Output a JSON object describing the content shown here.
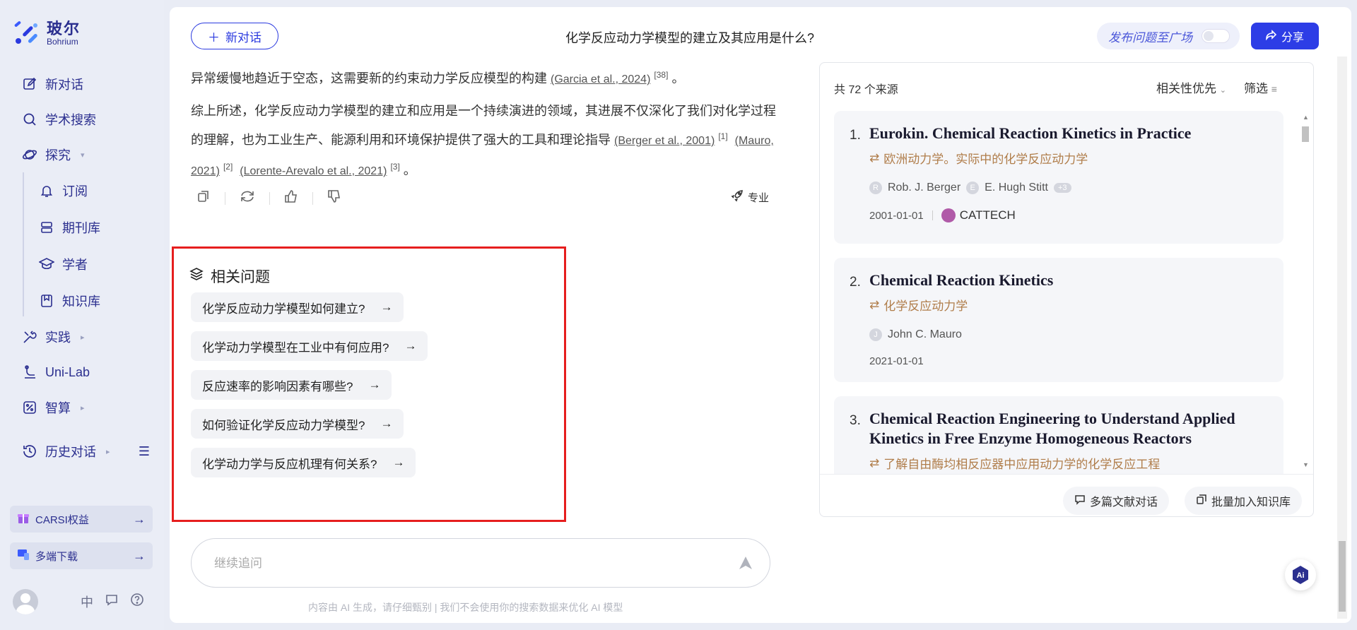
{
  "brand": {
    "name_cn": "玻尔",
    "name_en": "Bohrium"
  },
  "sidebar": {
    "items": [
      {
        "label": "新对话",
        "icon": "edit-icon"
      },
      {
        "label": "学术搜索",
        "icon": "search-icon"
      },
      {
        "label": "探究",
        "icon": "planet-icon"
      },
      {
        "label": "订阅",
        "icon": "bell-icon"
      },
      {
        "label": "期刊库",
        "icon": "journal-icon"
      },
      {
        "label": "学者",
        "icon": "scholar-icon"
      },
      {
        "label": "知识库",
        "icon": "knowledge-icon"
      },
      {
        "label": "实践",
        "icon": "tools-icon"
      },
      {
        "label": "Uni-Lab",
        "icon": "flask-icon"
      },
      {
        "label": "智算",
        "icon": "compute-icon"
      },
      {
        "label": "历史对话",
        "icon": "history-icon"
      }
    ],
    "promos": [
      {
        "label": "CARSI权益",
        "icon": "gift-icon"
      },
      {
        "label": "多端下载",
        "icon": "devices-icon"
      }
    ],
    "lang": "中"
  },
  "topbar": {
    "new_chat": "新对话",
    "title": "化学反应动力学模型的建立及其应用是什么?",
    "publish": "发布问题至广场",
    "share": "分享"
  },
  "article": {
    "p1_text": "异常缓慢地趋近于空态，这需要新的约束动力学反应模型的构建 ",
    "p1_cite": "(Garcia et al., 2024)",
    "p1_sup": "[38]",
    "p1_end": " 。",
    "p2_text": "综上所述，化学反应动力学模型的建立和应用是一个持续演进的领域，其进展不仅深化了我们对化学过程的理解，也为工业生产、能源利用和环境保护提供了强大的工具和理论指导 ",
    "p2_cite1": "(Berger et al., 2001)",
    "p2_sup1": "[1]",
    "p2_cite2": "(Mauro, 2021)",
    "p2_sup2": "[2]",
    "p2_cite3": "(Lorente-Arevalo et al., 2021)",
    "p2_sup3": "[3]",
    "p2_end": " 。",
    "pro_label": "专业"
  },
  "related": {
    "title": "相关问题",
    "questions": [
      "化学反应动力学模型如何建立?",
      "化学动力学模型在工业中有何应用?",
      "反应速率的影响因素有哪些?",
      "如何验证化学反应动力学模型?",
      "化学动力学与反应机理有何关系?"
    ]
  },
  "input": {
    "placeholder": "继续追问",
    "disclaimer": "内容由 AI 生成，请仔细甄别  |  我们不会使用你的搜索数据来优化 AI 模型"
  },
  "sources": {
    "count_label": "共 72 个来源",
    "sort_label": "相关性优先",
    "filter_label": "筛选",
    "cards": [
      {
        "num": "1.",
        "title": "Eurokin. Chemical Reaction Kinetics in Practice",
        "translation": "欧洲动力学。实际中的化学反应动力学",
        "author1_initial": "R",
        "author1": "Rob. J. Berger",
        "author2_initial": "E",
        "author2": "E. Hugh Stitt",
        "more": "+3",
        "date": "2001-01-01",
        "publisher": "CATTECH"
      },
      {
        "num": "2.",
        "title": "Chemical Reaction Kinetics",
        "translation": "化学反应动力学",
        "author1_initial": "J",
        "author1": "John C. Mauro",
        "date": "2021-01-01"
      },
      {
        "num": "3.",
        "title": "Chemical Reaction Engineering to Understand Applied Kinetics in Free Enzyme Homogeneous Reactors",
        "translation": "了解自由酶均相反应器中应用动力学的化学反应工程"
      }
    ],
    "btn_multi": "多篇文献对话",
    "btn_batch": "批量加入知识库"
  }
}
